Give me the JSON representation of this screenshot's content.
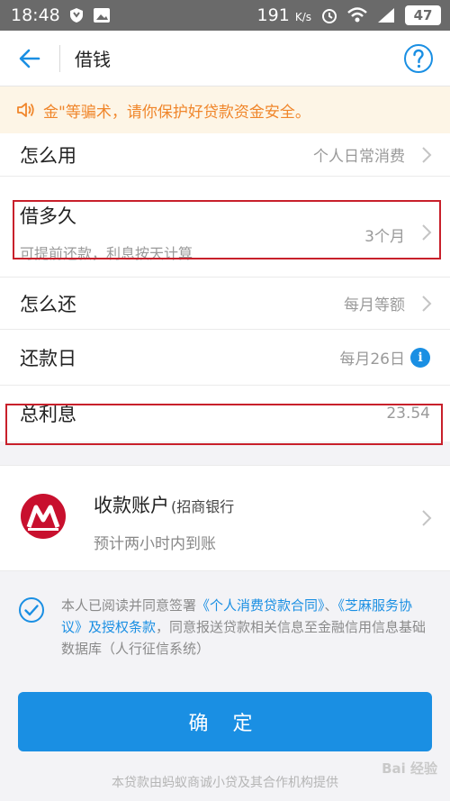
{
  "status_bar": {
    "time": "18:48",
    "net_speed": "191",
    "net_unit": "K/s",
    "battery": "47"
  },
  "nav": {
    "title": "借钱"
  },
  "notice": {
    "text": "金\"等骗术，请你保护好贷款资金安全。"
  },
  "rows": [
    {
      "label": "怎么用",
      "value": "个人日常消费"
    },
    {
      "label": "借多久",
      "sub": "可提前还款，利息按天计算",
      "value": "3个月"
    },
    {
      "label": "怎么还",
      "value": "每月等额"
    },
    {
      "label": "还款日",
      "value": "每月26日"
    },
    {
      "label": "总利息",
      "value": "23.54"
    }
  ],
  "account": {
    "title": "收款账户",
    "bank": "(招商银行",
    "subtitle": "预计两小时内到账"
  },
  "agreement": {
    "text_1": "本人已阅读并同意签署",
    "link_1": "《个人消费贷款合同》",
    "sep": "、",
    "link_2": "《芝麻服务协议》及授权条款",
    "text_2": "，同意报送贷款相关信息至金融信用信息基础数据库（人行征信系统）"
  },
  "confirm_label": "确 定",
  "footer": "本贷款由蚂蚁商诚小贷及其合作机构提供",
  "watermark": "Bai 经验",
  "colors": {
    "accent": "#1a8fe3",
    "notice_text": "#f0862b",
    "highlight": "#c8202b",
    "bank_red": "#c8102e"
  }
}
